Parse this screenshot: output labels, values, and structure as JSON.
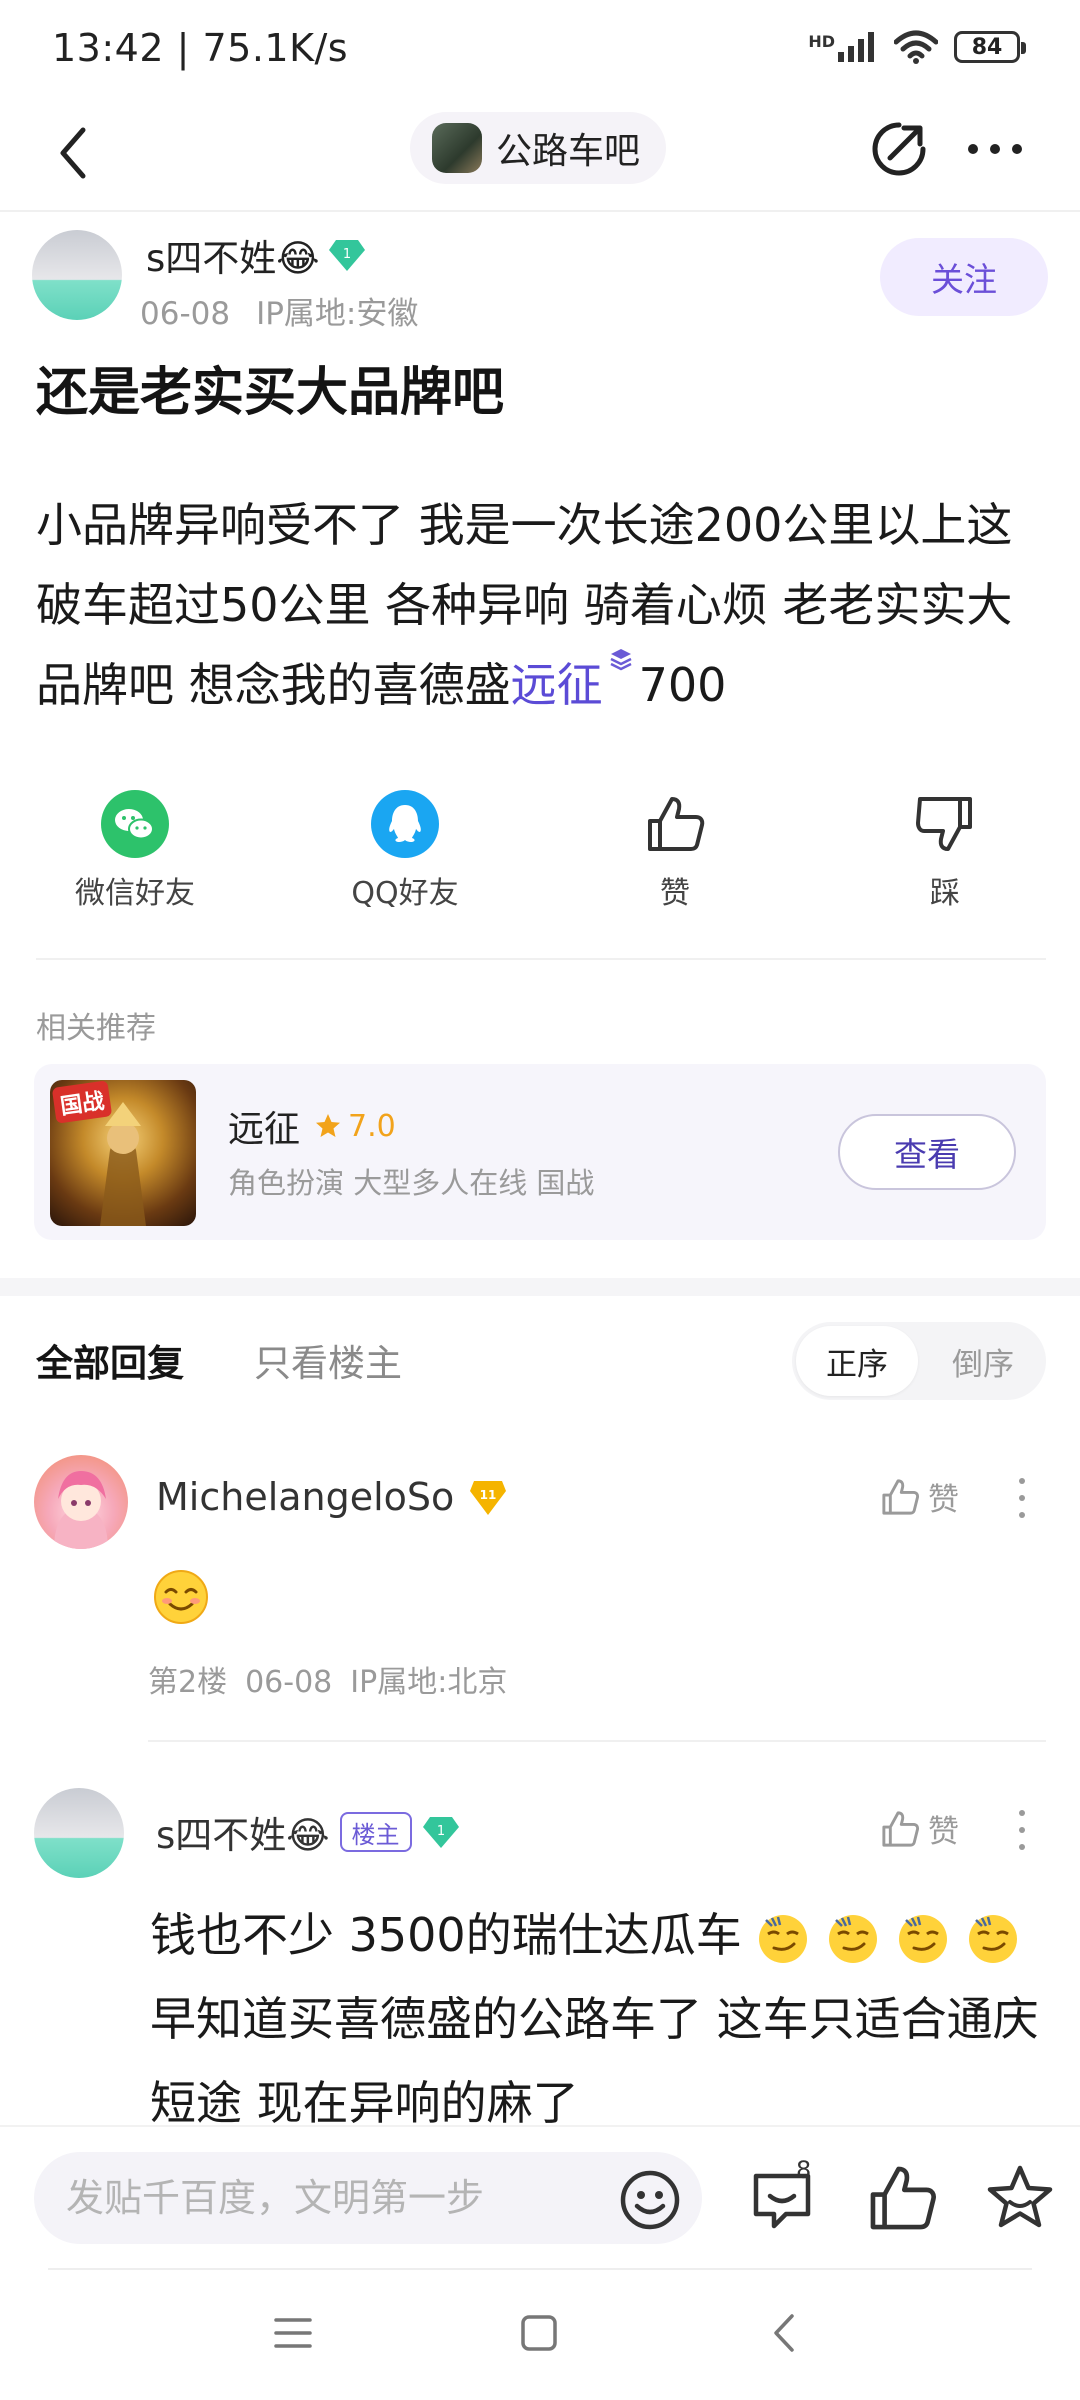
{
  "status_bar": {
    "time": "13:42 | 75.1K/s",
    "battery": "84",
    "network_label": "HD"
  },
  "nav": {
    "forum_name": "公路车吧"
  },
  "post": {
    "author": "s四不姓😂",
    "author_level": "1",
    "date": "06-08",
    "ip": "IP属地:安徽",
    "follow_label": "关注",
    "title": "还是老实买大品牌吧",
    "body_text": "小品牌异响受不了 我是一次长途200公里以上这破车超过50公里 各种异响 骑着心烦 老老实实大品牌吧 想念我的喜德盛",
    "body_link": "远征",
    "body_tail": "700"
  },
  "actions": [
    {
      "label": "微信好友",
      "icon": "wechat-icon"
    },
    {
      "label": "QQ好友",
      "icon": "qq-icon"
    },
    {
      "label": "赞",
      "icon": "thumbs-up-icon"
    },
    {
      "label": "踩",
      "icon": "thumbs-down-icon"
    }
  ],
  "recommend": {
    "section_label": "相关推荐",
    "thumb_tag": "国战",
    "title": "远征",
    "rating": "7.0",
    "tags": "角色扮演 大型多人在线 国战",
    "button": "查看"
  },
  "replies_header": {
    "tab_all": "全部回复",
    "tab_op": "只看楼主",
    "order_asc": "正序",
    "order_desc": "倒序"
  },
  "replies": [
    {
      "name": "MichelangeloSo",
      "badge": "11",
      "like_label": "赞",
      "floor": "第2楼",
      "date": "06-08",
      "ip": "IP属地:北京"
    },
    {
      "name": "s四不姓😂",
      "op_badge": "楼主",
      "level": "1",
      "like_label": "赞",
      "body_line1": "钱也不少 3500的瑞仕达瓜车",
      "body_rest": "早知道买喜德盛的公路车了 这车只适合通庆短途 现在异响的麻了"
    }
  ],
  "bottom_bar": {
    "input_placeholder": "发贴千百度，文明第一步",
    "comment_count": "8"
  },
  "colors": {
    "accent": "#6b4fd8",
    "link": "#5b4bd6",
    "wechat": "#2dc26b",
    "qq": "#1aa6f2",
    "star": "#f2a31b"
  }
}
